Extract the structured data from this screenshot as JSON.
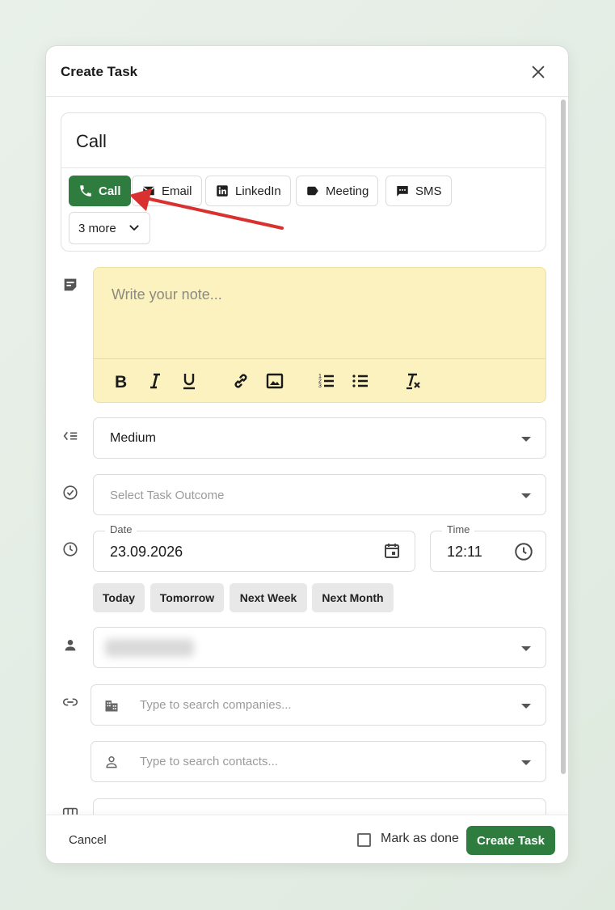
{
  "modal": {
    "title": "Create Task"
  },
  "title_input": {
    "value": "Call"
  },
  "task_types": [
    {
      "label": "Call",
      "icon": "phone-icon",
      "active": true
    },
    {
      "label": "Email",
      "icon": "email-icon"
    },
    {
      "label": "LinkedIn",
      "icon": "linkedin-icon"
    },
    {
      "label": "Meeting",
      "icon": "meeting-tag-icon"
    },
    {
      "label": "SMS",
      "icon": "sms-icon"
    },
    {
      "label": "3 more",
      "icon": "chevron-down-icon"
    }
  ],
  "note": {
    "placeholder": "Write your note..."
  },
  "priority": {
    "value": "Medium"
  },
  "outcome": {
    "placeholder": "Select Task Outcome"
  },
  "date": {
    "label": "Date",
    "value": "23.09.2026"
  },
  "time": {
    "label": "Time",
    "value": "12:11"
  },
  "quick_dates": [
    "Today",
    "Tomorrow",
    "Next Week",
    "Next Month"
  ],
  "companies": {
    "placeholder": "Type to search companies..."
  },
  "contacts": {
    "placeholder": "Type to search contacts..."
  },
  "footer": {
    "cancel": "Cancel",
    "mark_done": "Mark as done",
    "create": "Create Task"
  },
  "colors": {
    "accent": "#2e7d3f",
    "note_bg": "#fbf2bf",
    "annotation_arrow": "#d93030"
  }
}
